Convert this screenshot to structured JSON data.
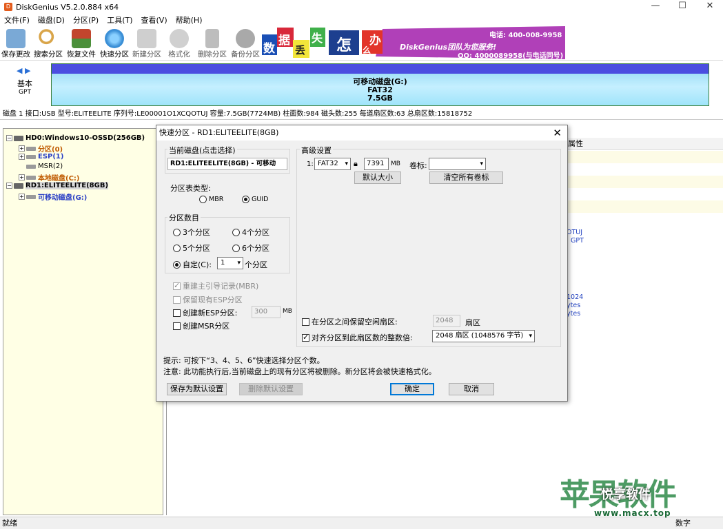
{
  "window": {
    "title": "DiskGenius V5.2.0.884 x64",
    "app_icon": "D"
  },
  "menu": [
    "文件(F)",
    "磁盘(D)",
    "分区(P)",
    "工具(T)",
    "查看(V)",
    "帮助(H)"
  ],
  "toolbar": [
    {
      "label": "保存更改",
      "icon": "save-icon",
      "color": "#7aa9d6"
    },
    {
      "label": "搜索分区",
      "icon": "search-icon",
      "color": "#d9a54a"
    },
    {
      "label": "恢复文件",
      "icon": "recover-icon",
      "color": "#c2452d"
    },
    {
      "label": "快速分区",
      "icon": "quick-partition-icon",
      "color": "#3b8fd6"
    },
    {
      "label": "新建分区",
      "icon": "new-partition-icon",
      "color": "#b9b9b9"
    },
    {
      "label": "格式化",
      "icon": "format-icon",
      "color": "#bdbdbd"
    },
    {
      "label": "删除分区",
      "icon": "trash-icon",
      "color": "#a8a8a8"
    },
    {
      "label": "备份分区",
      "icon": "backup-icon",
      "color": "#9c9c9c"
    }
  ],
  "ad": {
    "chars": [
      "数",
      "据",
      "丢",
      "失",
      "怎",
      "么",
      "办"
    ],
    "slogan": "DiskGenius团队为您服务!",
    "phone": "电话: 400-008-9958",
    "qq": "QQ: 4000089958(与电话同号)"
  },
  "disk_map": {
    "type": "基本",
    "scheme": "GPT",
    "partition_name": "可移动磁盘(G:)",
    "fs": "FAT32",
    "size": "7.5GB"
  },
  "info_line": "磁盘 1 接口:USB  型号:ELITEELITE  序列号:LE00001O1XCQOTUJ  容量:7.5GB(7724MB)  柱面数:984  磁头数:255  每道扇区数:63  总扇区数:15818752",
  "tree": {
    "hd0": "HD0:Windows10-OSSD(256GB)",
    "hd0_parts": [
      "分区(0)",
      "ESP(1)",
      "MSR(2)",
      "本地磁盘(C:)"
    ],
    "rd1": "RD1:ELITEELITE(8GB)",
    "rd1_parts": [
      "可移动磁盘(G:)"
    ]
  },
  "right_pane": {
    "header": "属性",
    "frag1": "OTUJ",
    "frag2": "GPT",
    "frag3": "1024",
    "frag4": "ytes",
    "frag5": "ytes"
  },
  "dialog": {
    "title": "快速分区 - RD1:ELITEELITE(8GB)",
    "current_disk_label": "当前磁盘(点击选择)",
    "current_disk_value": "RD1:ELITEELITE(8GB) - 可移动",
    "table_type_label": "分区表类型:",
    "mbr": "MBR",
    "guid": "GUID",
    "count_label": "分区数目",
    "opt3": "3个分区",
    "opt4": "4个分区",
    "opt5": "5个分区",
    "opt6": "6个分区",
    "custom": "自定(C):",
    "custom_value": "1",
    "custom_suffix": "个分区",
    "rebuild_mbr": "重建主引导记录(MBR)",
    "keep_esp": "保留现有ESP分区",
    "create_esp": "创建新ESP分区:",
    "esp_size": "300",
    "esp_unit": "MB",
    "create_msr": "创建MSR分区",
    "adv_label": "高级设置",
    "row_index": "1:",
    "fs_value": "FAT32",
    "size_value": "7391",
    "size_unit": "MB",
    "vol_label": "卷标:",
    "vol_value": "",
    "default_size_btn": "默认大小",
    "clear_labels_btn": "清空所有卷标",
    "reserve_free": "在分区之间保留空闲扇区:",
    "reserve_value": "2048",
    "reserve_unit": "扇区",
    "align": "对齐分区到此扇区数的整数倍:",
    "align_value": "2048 扇区 (1048576 字节)",
    "hint1": "提示: 可按下“3、4、5、6”快速选择分区个数。",
    "hint2": "注意: 此功能执行后,当前磁盘上的现有分区将被删除。新分区将会被快速格式化。",
    "save_default_btn": "保存为默认设置",
    "delete_default_btn": "删除默认设置",
    "ok_btn": "确定",
    "cancel_btn": "取消"
  },
  "status": {
    "left": "就绪",
    "right": "数字"
  },
  "watermark": {
    "text": "苹果软件",
    "wechat": "悦享软件",
    "url": "www.macx.top"
  }
}
